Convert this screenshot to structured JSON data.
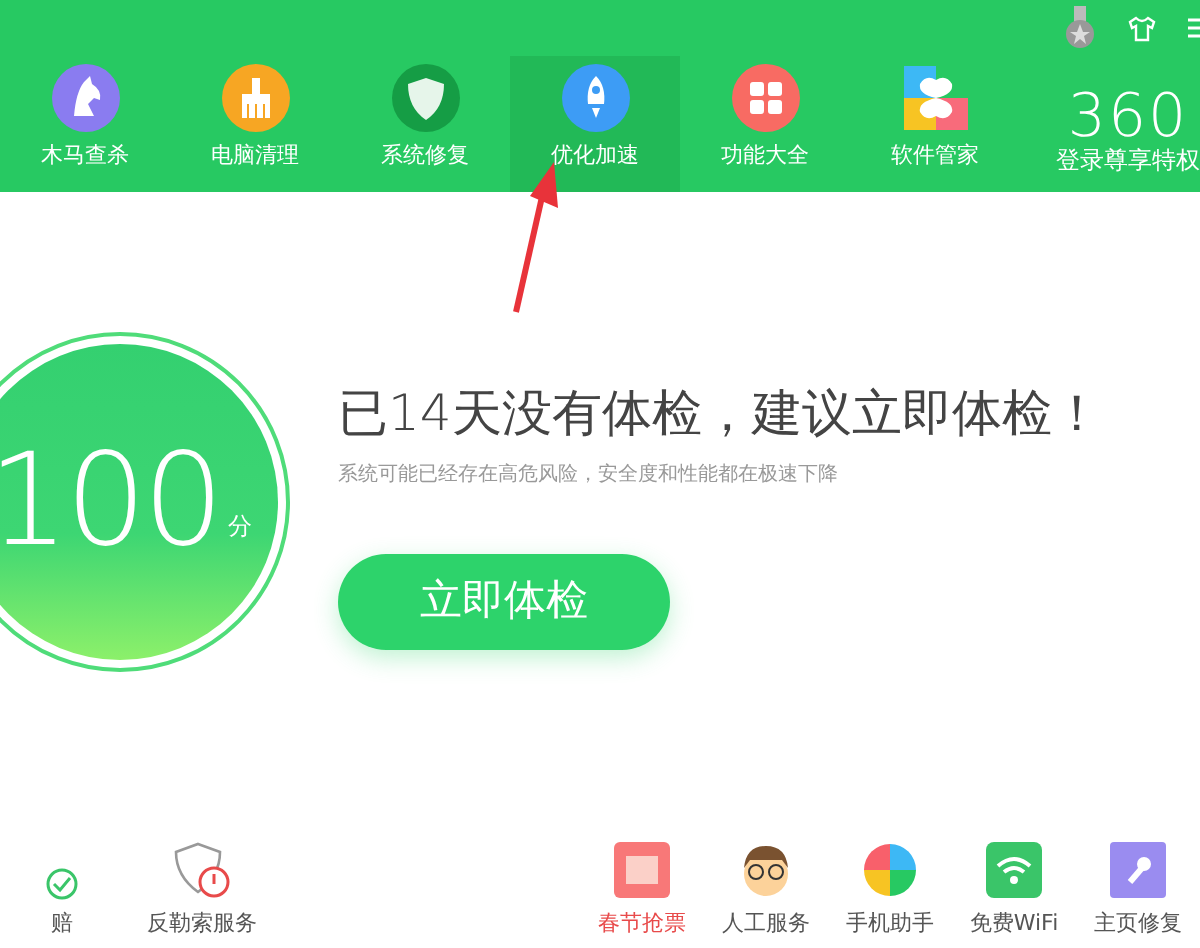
{
  "nav": [
    {
      "label": "木马查杀",
      "selected": false
    },
    {
      "label": "电脑清理",
      "selected": false
    },
    {
      "label": "系统修复",
      "selected": false
    },
    {
      "label": "优化加速",
      "selected": true
    },
    {
      "label": "功能大全",
      "selected": false
    },
    {
      "label": "软件管家",
      "selected": false
    }
  ],
  "account": {
    "logo": "360",
    "label": "登录尊享特权"
  },
  "score": {
    "value": "100",
    "unit": "分"
  },
  "headline": "已14天没有体检，建议立即体检！",
  "subtext": "系统可能已经存在高危风险，安全度和性能都在极速下降",
  "check_button": "立即体检",
  "bottom_left": [
    {
      "label": "赔",
      "highlight": false
    },
    {
      "label": "反勒索服务",
      "highlight": false
    }
  ],
  "bottom_right": [
    {
      "label": "春节抢票",
      "highlight": true
    },
    {
      "label": "人工服务",
      "highlight": false
    },
    {
      "label": "手机助手",
      "highlight": false
    },
    {
      "label": "免费WiFi",
      "highlight": false
    },
    {
      "label": "主页修复",
      "highlight": false
    }
  ]
}
